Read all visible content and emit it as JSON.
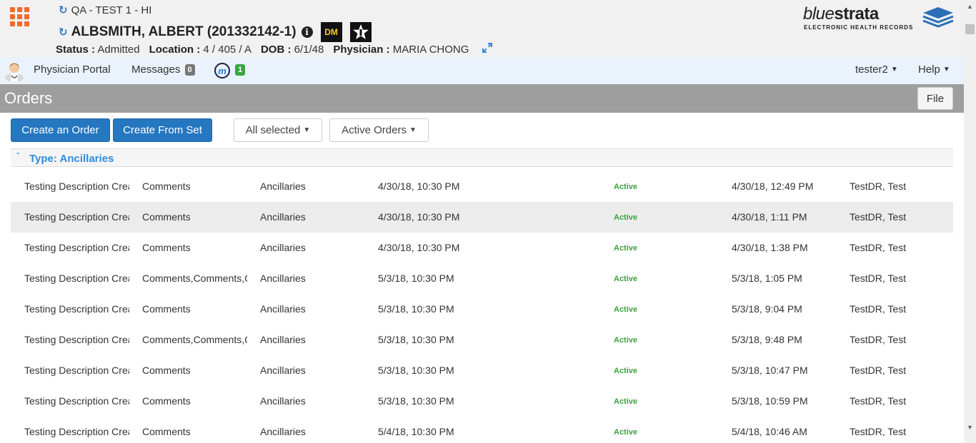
{
  "header": {
    "facility": "QA - TEST 1 - HI",
    "patient_name": "ALBSMITH, ALBERT (201332142-1)",
    "badge_dm": "DM",
    "status_label": "Status :",
    "status_value": "Admitted",
    "location_label": "Location :",
    "location_value": "4 / 405 / A",
    "dob_label": "DOB :",
    "dob_value": "6/1/48",
    "physician_label": "Physician :",
    "physician_value": "MARIA CHONG"
  },
  "logo": {
    "blue": "blue",
    "strata": "strata",
    "subtitle": "ELECTRONIC HEALTH RECORDS"
  },
  "nav": {
    "physician_portal": "Physician Portal",
    "messages": "Messages",
    "messages_count": "0",
    "m_count": "1",
    "m_letter": "m",
    "user": "tester2",
    "help": "Help"
  },
  "page": {
    "title": "Orders",
    "file_label": "File"
  },
  "toolbar": {
    "create_order": "Create an Order",
    "create_from_set": "Create From Set",
    "filter_selected": "All selected",
    "filter_orders": "Active Orders"
  },
  "group": {
    "title": "Type: Ancillaries"
  },
  "rows": [
    {
      "desc": "Testing Description Created",
      "comments": "Comments",
      "type": "Ancillaries",
      "start": "4/30/18, 10:30 PM",
      "status": "Active",
      "entered": "4/30/18, 12:49 PM",
      "by": "TestDR, Test"
    },
    {
      "desc": "Testing Description Created",
      "comments": "Comments",
      "type": "Ancillaries",
      "start": "4/30/18, 10:30 PM",
      "status": "Active",
      "entered": "4/30/18, 1:11 PM",
      "by": "TestDR, Test"
    },
    {
      "desc": "Testing Description Created",
      "comments": "Comments",
      "type": "Ancillaries",
      "start": "4/30/18, 10:30 PM",
      "status": "Active",
      "entered": "4/30/18, 1:38 PM",
      "by": "TestDR, Test"
    },
    {
      "desc": "Testing Description Created",
      "comments": "Comments,Comments,Comments",
      "type": "Ancillaries",
      "start": "5/3/18, 10:30 PM",
      "status": "Active",
      "entered": "5/3/18, 1:05 PM",
      "by": "TestDR, Test"
    },
    {
      "desc": "Testing Description Created",
      "comments": "Comments",
      "type": "Ancillaries",
      "start": "5/3/18, 10:30 PM",
      "status": "Active",
      "entered": "5/3/18, 9:04 PM",
      "by": "TestDR, Test"
    },
    {
      "desc": "Testing Description Created",
      "comments": "Comments,Comments,Comments",
      "type": "Ancillaries",
      "start": "5/3/18, 10:30 PM",
      "status": "Active",
      "entered": "5/3/18, 9:48 PM",
      "by": "TestDR, Test"
    },
    {
      "desc": "Testing Description Created",
      "comments": "Comments",
      "type": "Ancillaries",
      "start": "5/3/18, 10:30 PM",
      "status": "Active",
      "entered": "5/3/18, 10:47 PM",
      "by": "TestDR, Test"
    },
    {
      "desc": "Testing Description Created",
      "comments": "Comments",
      "type": "Ancillaries",
      "start": "5/3/18, 10:30 PM",
      "status": "Active",
      "entered": "5/3/18, 10:59 PM",
      "by": "TestDR, Test"
    },
    {
      "desc": "Testing Description Created",
      "comments": "Comments",
      "type": "Ancillaries",
      "start": "5/4/18, 10:30 PM",
      "status": "Active",
      "entered": "5/4/18, 10:46 AM",
      "by": "TestDR, Test"
    }
  ]
}
